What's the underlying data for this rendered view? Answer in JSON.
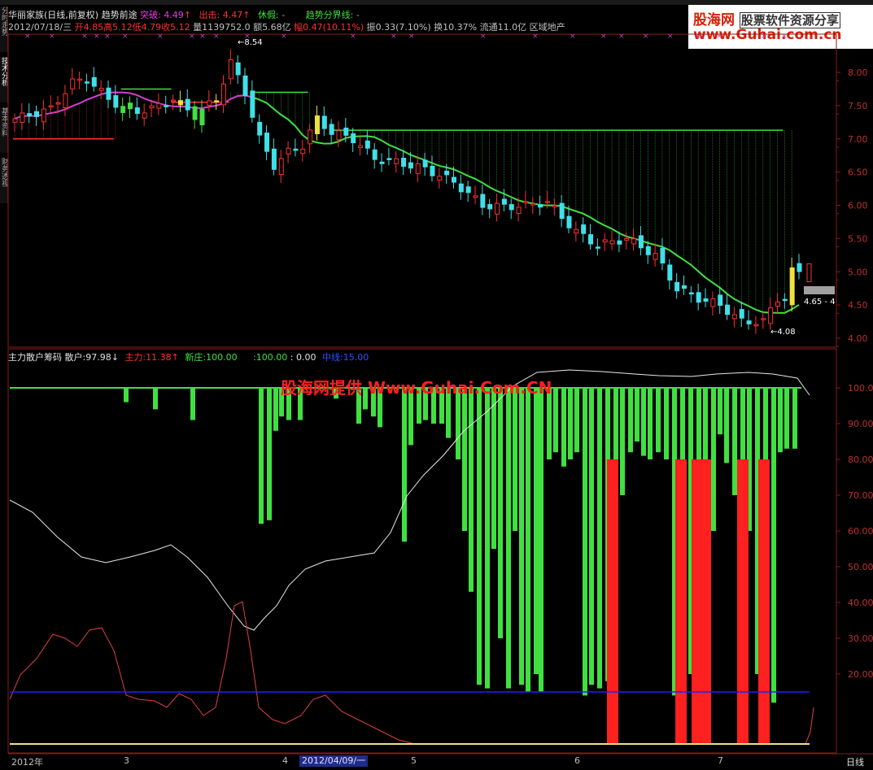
{
  "header": {
    "title_line": {
      "name": "华丽家族(日线,前复权)",
      "indicator": "趋势前途",
      "break_label": "突破:",
      "break_value": "4.49",
      "out_label": "出击:",
      "out_value": "4.47",
      "rest_label": "休假:",
      "rest_value": "-",
      "trend_label": "趋势分界线:",
      "trend_value": "-"
    },
    "quote_line": {
      "date": "2012/07/18/三",
      "open": "开4.85",
      "high": "高5.12",
      "low": "低4.79",
      "close": "收5.12",
      "volume": "量1139752.0",
      "amount": "额5.68亿",
      "change": "幅0.47(10.11%)",
      "amplitude": "振0.33(7.10%)",
      "turnover": "换10.37%",
      "float": "流通11.0亿",
      "sector": "区域地产"
    }
  },
  "logo": {
    "part1": "股海网",
    "part2": "股票软件资源分享",
    "url": "www.Guhai.com.cn"
  },
  "left_tabs": [
    "分时走势",
    "技术分析",
    "基本资料",
    "财务透视"
  ],
  "price_panel": {
    "yaxis": [
      "8.00",
      "7.50",
      "7.00",
      "6.50",
      "6.00",
      "5.50",
      "5.00",
      "4.50",
      "4.00"
    ],
    "high_label": "8.54",
    "low_label": "4.08",
    "last_label": "4.65",
    "last_label_suffix": "- 4",
    "colors": {
      "up": "#ff3030",
      "down": "#40e0e8",
      "ma": "#40e040",
      "ma_early": "#d040d0",
      "hline_green": "#40e040",
      "hline_red": "#ff3030",
      "yellow": "#f0e040"
    }
  },
  "indicator_panel": {
    "title": "主力散户筹码",
    "retail_label": "散户:",
    "retail_value": "97.98",
    "main_label": "主力:",
    "main_value": "11.38",
    "new_label": "新庄:",
    "new_value": "100.00",
    "c_value": ":100.00",
    "d_value": ": 0.00",
    "mid_label": "中线:",
    "mid_value": "15.00",
    "watermark": "股海网提供 Www.Guhai.Com.CN",
    "yaxis": [
      "100.00",
      "90.00",
      "80.00",
      "70.00",
      "60.00",
      "50.00",
      "40.00",
      "30.00",
      "20.00"
    ],
    "colors": {
      "retail": "#40e040",
      "main": "#ff2020",
      "white_line": "#e8e8e8",
      "red_line": "#e04040",
      "blue_line": "#2020ff",
      "yellow_line": "#f0e080"
    }
  },
  "xaxis": {
    "labels": [
      "2012年",
      "3",
      "4",
      "2012/04/09/一",
      "5",
      "6",
      "7"
    ],
    "period": "日线"
  }
}
